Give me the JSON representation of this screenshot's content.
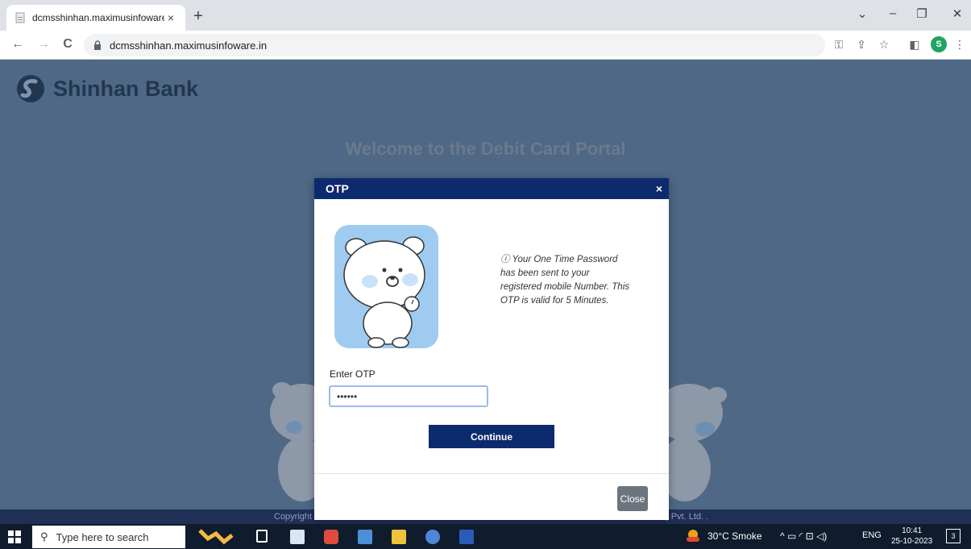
{
  "browser": {
    "tab_title": "dcmsshinhan.maximusinfoware.",
    "tab_close": "×",
    "new_tab": "+",
    "url": "dcmsshinhan.maximusinfoware.in",
    "profile_initial": "S",
    "window_controls": {
      "tab_search": "⌄",
      "minimize": "–",
      "restore": "❐",
      "close": "✕"
    },
    "nav": {
      "back": "←",
      "forward": "→",
      "reload": "C"
    },
    "toolbar_icons": {
      "key": "⚿",
      "share": "⇪",
      "bookmark": "☆",
      "sidepanel": "◧",
      "menu": "⋮"
    }
  },
  "page": {
    "brand": "Shinhan Bank",
    "welcome": "Welcome to the Debit Card Portal",
    "footer_left": "Copyright",
    "footer_right": ") Pvt. Ltd. ."
  },
  "modal": {
    "title": "OTP",
    "close_x": "×",
    "info_icon": "ⓘ",
    "info_text": "Your One Time Password has been sent to your registered mobile Number. This OTP is valid for 5 Minutes.",
    "otp_label": "Enter OTP",
    "otp_value": "••••••",
    "continue_label": "Continue",
    "close_label": "Close"
  },
  "taskbar": {
    "search_placeholder": "Type here to search",
    "search_icon": "⚲",
    "weather": "30°C Smoke",
    "tray_icons": "^ ▭ ◜ ⊡ ◁)",
    "language": "ENG",
    "time": "10:41",
    "date": "25-10-2023",
    "notification_count": "3"
  },
  "colors": {
    "header_blue": "#0e2a6f",
    "page_bg": "#4e6885",
    "close_gray": "#6c757d"
  }
}
